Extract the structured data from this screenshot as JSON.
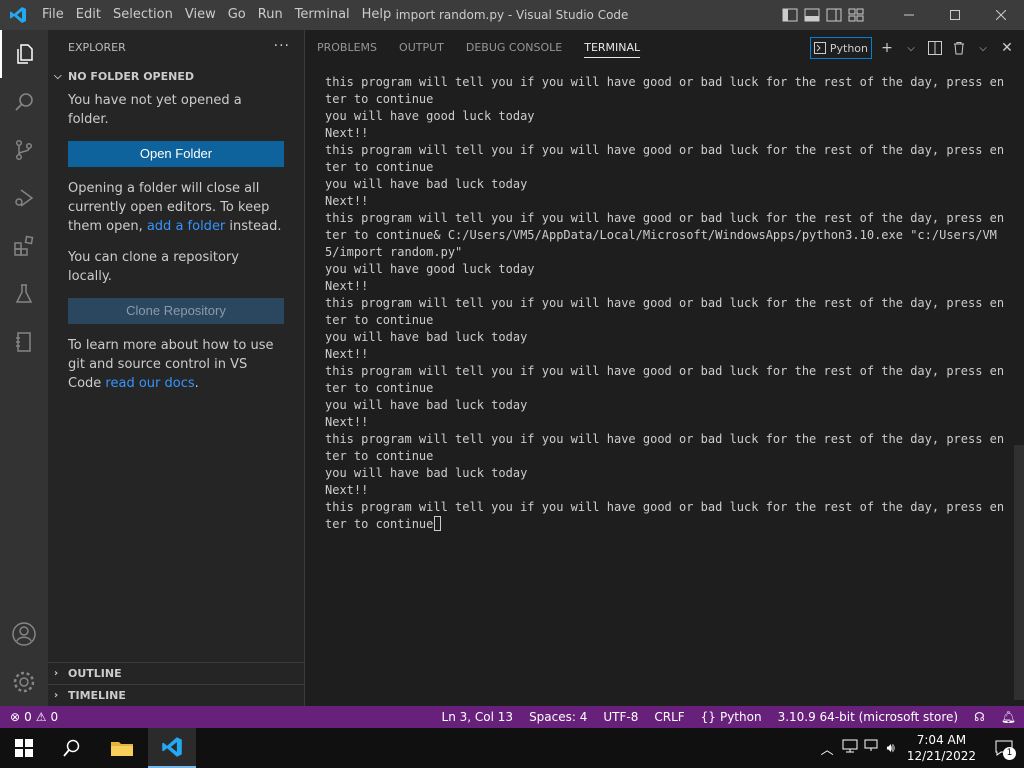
{
  "window": {
    "title": "import random.py - Visual Studio Code",
    "menu": [
      "File",
      "Edit",
      "Selection",
      "View",
      "Go",
      "Run",
      "Terminal",
      "Help"
    ]
  },
  "activity_bar": {
    "items": [
      "explorer-icon",
      "search-icon",
      "source-control-icon",
      "run-debug-icon",
      "extensions-icon",
      "testing-icon",
      "notebook-icon"
    ],
    "bottom": [
      "account-icon",
      "settings-gear-icon"
    ]
  },
  "sidebar": {
    "header": "EXPLORER",
    "section": "NO FOLDER OPENED",
    "not_opened": "You have not yet opened a folder.",
    "open_folder_button": "Open Folder",
    "closing_text_1": "Opening a folder will close all currently open editors. To keep them open, ",
    "add_folder_link": "add a folder",
    "closing_text_2": " instead.",
    "clone_text": "You can clone a repository locally.",
    "clone_button": "Clone Repository",
    "learn_text": "To learn more about how to use git and source control in VS Code ",
    "docs_link": "read our docs",
    "learn_end": ".",
    "outline": "OUTLINE",
    "timeline": "TIMELINE"
  },
  "panel": {
    "tabs": [
      "PROBLEMS",
      "OUTPUT",
      "DEBUG CONSOLE",
      "TERMINAL"
    ],
    "active_tab": "TERMINAL",
    "terminal_profile": "Python"
  },
  "terminal": {
    "lines": [
      "this program will tell you if you will have good or bad luck for the rest of the day, press enter to continue",
      "you will have good luck today",
      "Next!!",
      "this program will tell you if you will have good or bad luck for the rest of the day, press enter to continue",
      "you will have bad luck today",
      "Next!!",
      "this program will tell you if you will have good or bad luck for the rest of the day, press enter to continue& C:/Users/VM5/AppData/Local/Microsoft/WindowsApps/python3.10.exe \"c:/Users/VM5/import random.py\"",
      "you will have good luck today",
      "Next!!",
      "this program will tell you if you will have good or bad luck for the rest of the day, press enter to continue",
      "you will have bad luck today",
      "Next!!",
      "this program will tell you if you will have good or bad luck for the rest of the day, press enter to continue",
      "you will have bad luck today",
      "Next!!",
      "this program will tell you if you will have good or bad luck for the rest of the day, press enter to continue",
      "you will have bad luck today",
      "Next!!",
      "this program will tell you if you will have good or bad luck for the rest of the day, press enter to continue"
    ]
  },
  "statusbar": {
    "errors": "0",
    "warnings": "0",
    "position": "Ln 3, Col 13",
    "spaces": "Spaces: 4",
    "encoding": "UTF-8",
    "eol": "CRLF",
    "language": "Python",
    "interpreter": "3.10.9 64-bit (microsoft store)",
    "color": "#68217a"
  },
  "taskbar": {
    "time": "7:04 AM",
    "date": "12/21/2022",
    "notifications": "1"
  }
}
